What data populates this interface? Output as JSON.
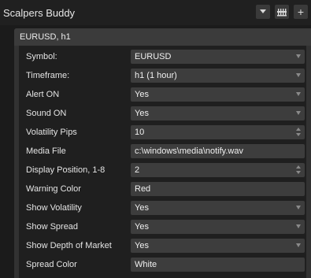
{
  "window": {
    "title": "Scalpers Buddy",
    "buttons": [
      {
        "icon": "chevron-down-icon"
      },
      {
        "icon": "settings-sliders-icon"
      },
      {
        "icon": "plus-icon",
        "glyph": "+"
      }
    ]
  },
  "panel": {
    "title": "EURUSD, h1"
  },
  "settings": [
    {
      "label": "Symbol:",
      "value": "EURUSD",
      "control": "dropdown"
    },
    {
      "label": "Timeframe:",
      "value": "h1 (1 hour)",
      "control": "dropdown"
    },
    {
      "label": "Alert ON",
      "value": "Yes",
      "control": "dropdown"
    },
    {
      "label": "Sound ON",
      "value": "Yes",
      "control": "dropdown"
    },
    {
      "label": "Volatility Pips",
      "value": "10",
      "control": "spinner"
    },
    {
      "label": "Media File",
      "value": "c:\\windows\\media\\notify.wav",
      "control": "text"
    },
    {
      "label": "Display Position, 1-8",
      "value": "2",
      "control": "spinner"
    },
    {
      "label": "Warning Color",
      "value": "Red",
      "control": "text"
    },
    {
      "label": "Show Volatility",
      "value": "Yes",
      "control": "dropdown"
    },
    {
      "label": "Show Spread",
      "value": "Yes",
      "control": "dropdown"
    },
    {
      "label": "Show Depth of Market",
      "value": "Yes",
      "control": "dropdown"
    },
    {
      "label": "Spread Color",
      "value": "White",
      "control": "text"
    }
  ],
  "colors": {
    "background": "#1b1b1b",
    "panel": "#323232",
    "field": "#3d3d3d",
    "text": "#e6e6e6"
  }
}
